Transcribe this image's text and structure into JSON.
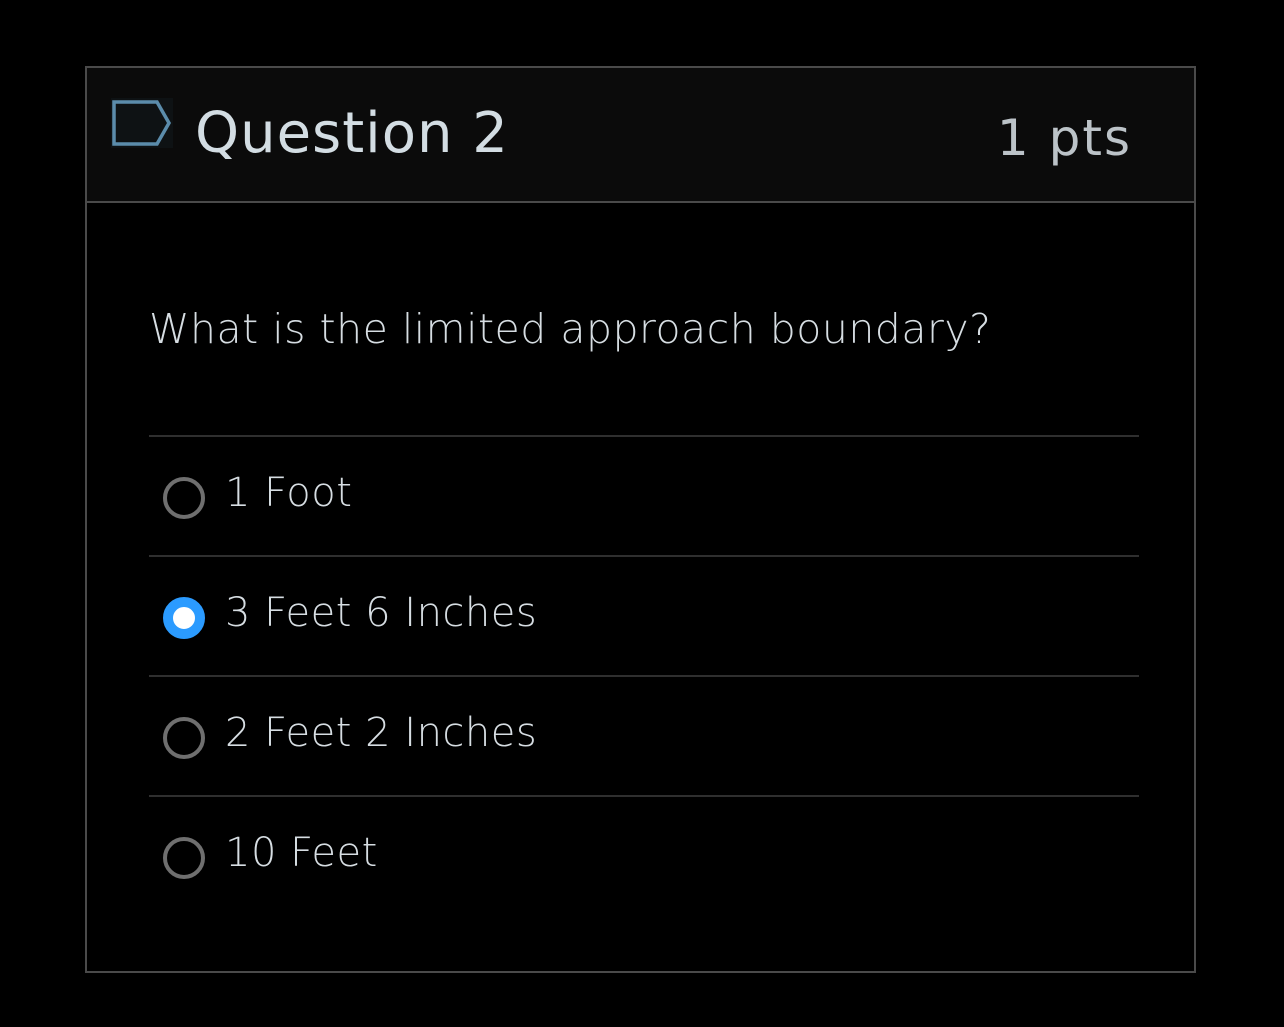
{
  "question": {
    "title": "Question 2",
    "points": "1 pts",
    "flag_icon": "flag-icon",
    "text": "What is the limited approach boundary?",
    "answers": [
      {
        "label": "1 Foot",
        "selected": false
      },
      {
        "label": "3 Feet 6 Inches",
        "selected": true
      },
      {
        "label": "2 Feet 2 Inches",
        "selected": false
      },
      {
        "label": "10 Feet",
        "selected": false
      }
    ]
  },
  "colors": {
    "accent": "#2b9bff",
    "border": "#4a4a4a",
    "header_bg": "#0b0b0b",
    "background": "#000000"
  }
}
